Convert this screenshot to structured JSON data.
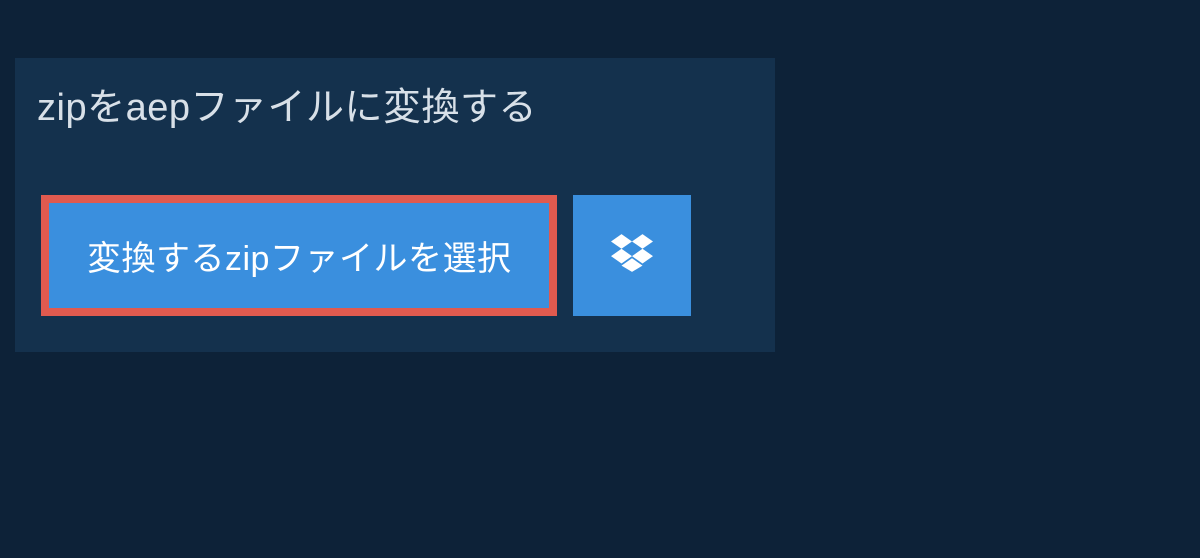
{
  "heading": "zipをaepファイルに変換する",
  "selectButton": "変換するzipファイルを選択",
  "colors": {
    "background": "#0d2238",
    "panel": "#14314d",
    "buttonBg": "#3a8fde",
    "highlightBorder": "#e05a4f",
    "textLight": "#d8e0e8"
  }
}
